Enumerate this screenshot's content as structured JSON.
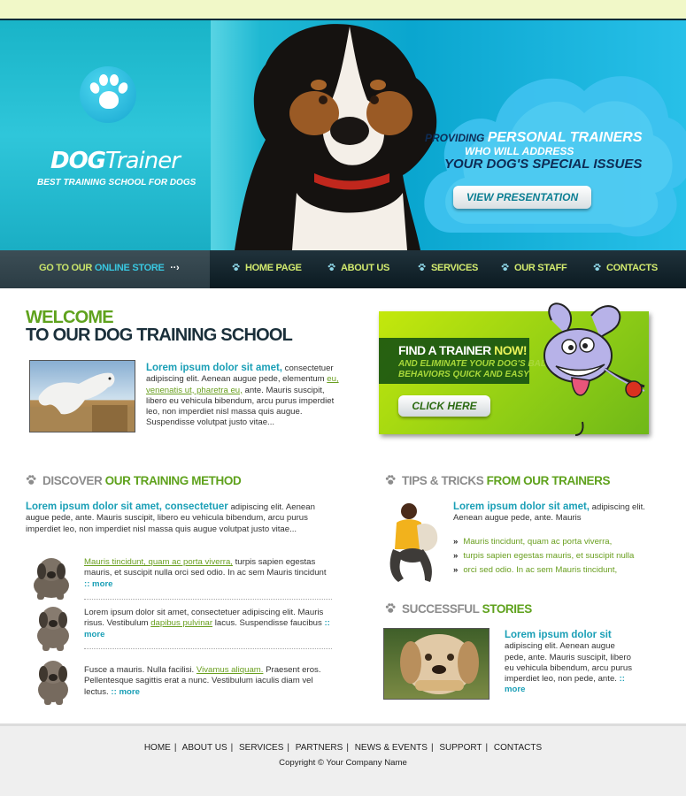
{
  "header": {
    "logo_title_bold": "DOG",
    "logo_title_rest": "Trainer",
    "logo_subtitle": "BEST TRAINING SCHOOL FOR DOGS",
    "promo_providing": "PROVIDING",
    "promo_personal": "PERSONAL TRAINERS",
    "promo_who": "WHO WILL ADDRESS",
    "promo_issues": "YOUR DOG'S SPECIAL ISSUES",
    "presentation_button": "VIEW PRESENTATION"
  },
  "nav": {
    "store_prefix": "GO TO OUR",
    "store_highlight": "ONLINE STORE",
    "store_arrow": "··›",
    "items": [
      {
        "label": "HOME PAGE"
      },
      {
        "label": "ABOUT US"
      },
      {
        "label": "SERVICES"
      },
      {
        "label": "OUR STAFF"
      },
      {
        "label": "CONTACTS"
      }
    ]
  },
  "welcome": {
    "title_line1": "WELCOME",
    "title_line2": "TO OUR DOG TRAINING SCHOOL",
    "lead": "Lorem ipsum dolor sit amet,",
    "text1": " consectetuer adipiscing elit. Aenean augue pede, elementum ",
    "link": "eu, venenatis ut, pharetra eu,",
    "text2": " ante. Mauris suscipit, libero eu vehicula bibendum, arcu purus imperdiet leo, non imperdiet nisl massa quis augue. Suspendisse volutpat justo vitae..."
  },
  "trainer_banner": {
    "find_prefix": "FIND A TRAINER ",
    "find_now": "NOW!",
    "eliminate": "AND ELIMINATE YOUR DOG'S BAD BEHAVIORS QUICK AND EASY",
    "click_button": "CLICK HERE"
  },
  "method": {
    "title_gray": "DISCOVER",
    "title_green": "OUR TRAINING METHOD",
    "lead": "Lorem ipsum dolor sit amet, consectetuer",
    "intro": " adipiscing elit. Aenean augue pede, ante. Mauris suscipit, libero eu vehicula bibendum, arcu purus imperdiet leo, non imperdiet nisl massa quis augue volutpat justo vitae...",
    "items": [
      {
        "pre": "",
        "link": "Mauris tincidunt, quam ac porta viverra,",
        "post": " turpis sapien egestas mauris, et suscipit nulla orci sed odio. In ac sem Mauris tincidunt ",
        "more": ":: more"
      },
      {
        "pre": "Lorem ipsum dolor sit amet, consectetuer adipiscing elit. Mauris risus. Vestibulum ",
        "link": "dapibus pulvinar",
        "post": " lacus. Suspendisse faucibus ",
        "more": ":: more"
      },
      {
        "pre": "Fusce a mauris. Nulla facilisi. ",
        "link": "Vivamus aliquam.",
        "post": " Praesent eros. Pellentesque sagittis erat a nunc. Vestibulum iaculis diam vel lectus. ",
        "more": ":: more"
      }
    ]
  },
  "tips": {
    "title_gray": "TIPS & TRICKS",
    "title_green": "FROM OUR TRAINERS",
    "lead": "Lorem ipsum dolor sit amet,",
    "text": " adipiscing elit. Aenean augue pede, ante. Mauris",
    "list": [
      "Mauris tincidunt, quam ac porta viverra,",
      "turpis sapien egestas mauris, et suscipit nulla",
      "orci sed odio. In ac sem Mauris tincidunt,"
    ],
    "arrow": "»"
  },
  "stories": {
    "title_gray": "SUCCESSFUL",
    "title_green": "STORIES",
    "lead": "Lorem ipsum dolor sit",
    "text": " adipiscing elit. Aenean augue pede, ante. Mauris suscipit, libero eu vehicula bibendum, arcu purus imperdiet leo, non pede, ante. ",
    "more": ":: more"
  },
  "footer": {
    "links": [
      "HOME",
      "ABOUT US",
      "SERVICES",
      "PARTNERS",
      "NEWS & EVENTS",
      "SUPPORT",
      "CONTACTS"
    ],
    "separator": "|",
    "copyright": "Copyright © Your Company Name"
  },
  "colors": {
    "accent_green": "#5fa21d",
    "accent_cyan": "#1a9fb6",
    "nav_text": "#d2ea6e",
    "dark_navy": "#1a2f3a"
  }
}
